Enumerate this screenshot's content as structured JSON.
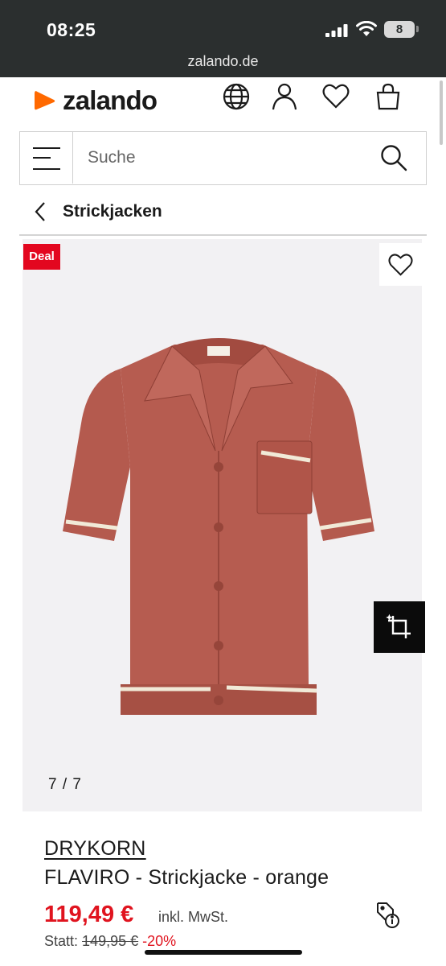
{
  "status_bar": {
    "time": "08:25",
    "battery": "8"
  },
  "browser": {
    "url": "zalando.de"
  },
  "header": {
    "logo_text": "zalando",
    "brand_color": "#ff6900",
    "icons": [
      "globe-icon",
      "account-icon",
      "wishlist-icon",
      "bag-icon"
    ]
  },
  "search": {
    "placeholder": "Suche"
  },
  "breadcrumb": {
    "label": "Strickjacken"
  },
  "gallery": {
    "badge": "Deal",
    "counter": "7 / 7",
    "product_color": "#b65a4f"
  },
  "product": {
    "brand": "DRYKORN",
    "name": "FLAVIRO - Strickjacke - orange",
    "price": "119,49 €",
    "vat_note": "inkl. MwSt.",
    "old_price_label": "Statt:",
    "old_price": "149,95 €",
    "discount": "-20%",
    "price_color": "#e0141f"
  }
}
